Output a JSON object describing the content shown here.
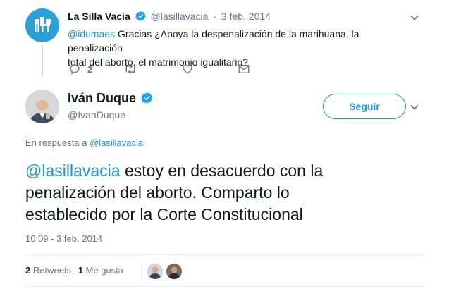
{
  "original_tweet": {
    "author_name": "La Silla Vacía",
    "handle": "@lasillavacia",
    "separator": "·",
    "date": "3 feb. 2014",
    "mention": "@idumaes",
    "text_line1_rest": " Gracias ¿Apoya la despenalización de la marihuana, la penalización",
    "text_line2": "total del aborto, el matrimonio igualitario?",
    "reply_count": "2"
  },
  "main_tweet": {
    "author_name": "Iván Duque",
    "handle": "@IvanDuque",
    "follow_label": "Seguir",
    "reply_to_prefix": "En respuesta a ",
    "reply_to_handle": "@lasillavacia",
    "mention": "@lasillavacia",
    "text_line1_rest": " estoy en desacuerdo con la",
    "text_line2": "penalización del aborto. Comparto lo",
    "text_line3": "establecido por la Corte Constitucional",
    "timestamp": "10:09 - 3 feb. 2014",
    "retweets_count": "2",
    "retweets_label": "Retweets",
    "likes_count": "1",
    "likes_label": "Me gusta"
  },
  "colors": {
    "accent": "#1b95e0",
    "muted": "#657786",
    "verified": "#1da1f2"
  },
  "icons": [
    "reply-icon",
    "retweet-icon",
    "like-icon",
    "message-icon",
    "chevron-down-icon",
    "verified-badge-icon"
  ]
}
